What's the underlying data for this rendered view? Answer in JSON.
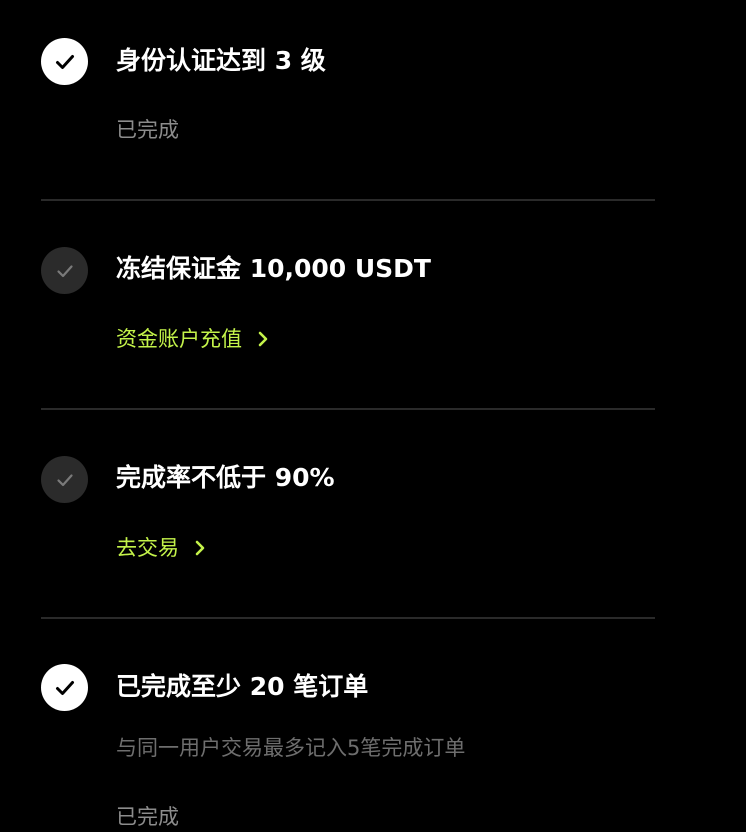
{
  "colors": {
    "background": "#000000",
    "text_primary": "#ffffff",
    "text_muted": "#8c8c8c",
    "accent_link": "#c4f34a",
    "check_done_bg": "#ffffff",
    "check_pending_bg": "#2b2b2b",
    "divider": "#2a2a2a"
  },
  "requirements": [
    {
      "title": "身份认证达到 3 级",
      "status": "done",
      "icon": "check-icon",
      "status_text": "已完成"
    },
    {
      "title": "冻结保证金 10,000 USDT",
      "status": "pending",
      "icon": "check-icon",
      "link_label": "资金账户充值",
      "link_icon": "chevron-right-icon"
    },
    {
      "title": "完成率不低于 90%",
      "status": "pending",
      "icon": "check-icon",
      "link_label": "去交易",
      "link_icon": "chevron-right-icon"
    },
    {
      "title": "已完成至少 20 笔订单",
      "status": "done",
      "icon": "check-icon",
      "note": "与同一用户交易最多记入5笔完成订单",
      "status_text": "已完成"
    }
  ]
}
